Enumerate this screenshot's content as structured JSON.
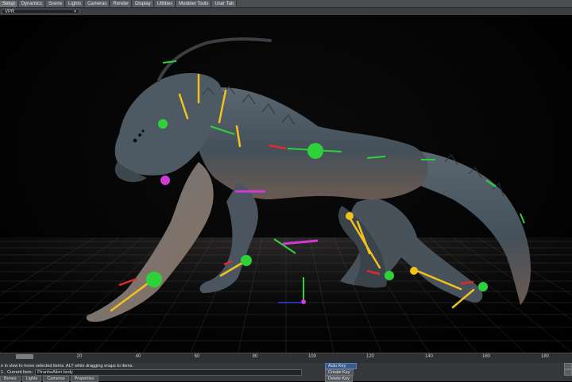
{
  "menu": {
    "tabs": [
      {
        "label": "Setup"
      },
      {
        "label": "Dynamics"
      },
      {
        "label": "Scene"
      },
      {
        "label": "Lights"
      },
      {
        "label": "Cameras"
      },
      {
        "label": "Render"
      },
      {
        "label": "Display"
      },
      {
        "label": "Utilities"
      },
      {
        "label": "Modeler Tools"
      },
      {
        "label": "User Tab"
      }
    ]
  },
  "viewport": {
    "view_mode": "VPR"
  },
  "timeline": {
    "ticks": [
      "20",
      "40",
      "60",
      "80",
      "100",
      "120",
      "140",
      "160",
      "180"
    ]
  },
  "status": {
    "hint": "e in view to move selected items. ALT while dragging snaps to items.",
    "current_item_label": "Current Item:",
    "current_item_value": "PiranhaAlien:body",
    "auto_key": "Auto Key",
    "create_key": "Create Key",
    "delete_key": "Delete Key",
    "tabs": [
      {
        "label": "Bones"
      },
      {
        "label": "Lights"
      },
      {
        "label": "Cameras"
      },
      {
        "label": "Properties"
      }
    ],
    "frame_number": "1"
  },
  "colors": {
    "accent_blue": "#3a5c8c",
    "handle_green": "#2fd13a",
    "handle_yellow": "#f2c21a",
    "handle_red": "#e32a2a",
    "handle_magenta": "#d23ad8"
  }
}
